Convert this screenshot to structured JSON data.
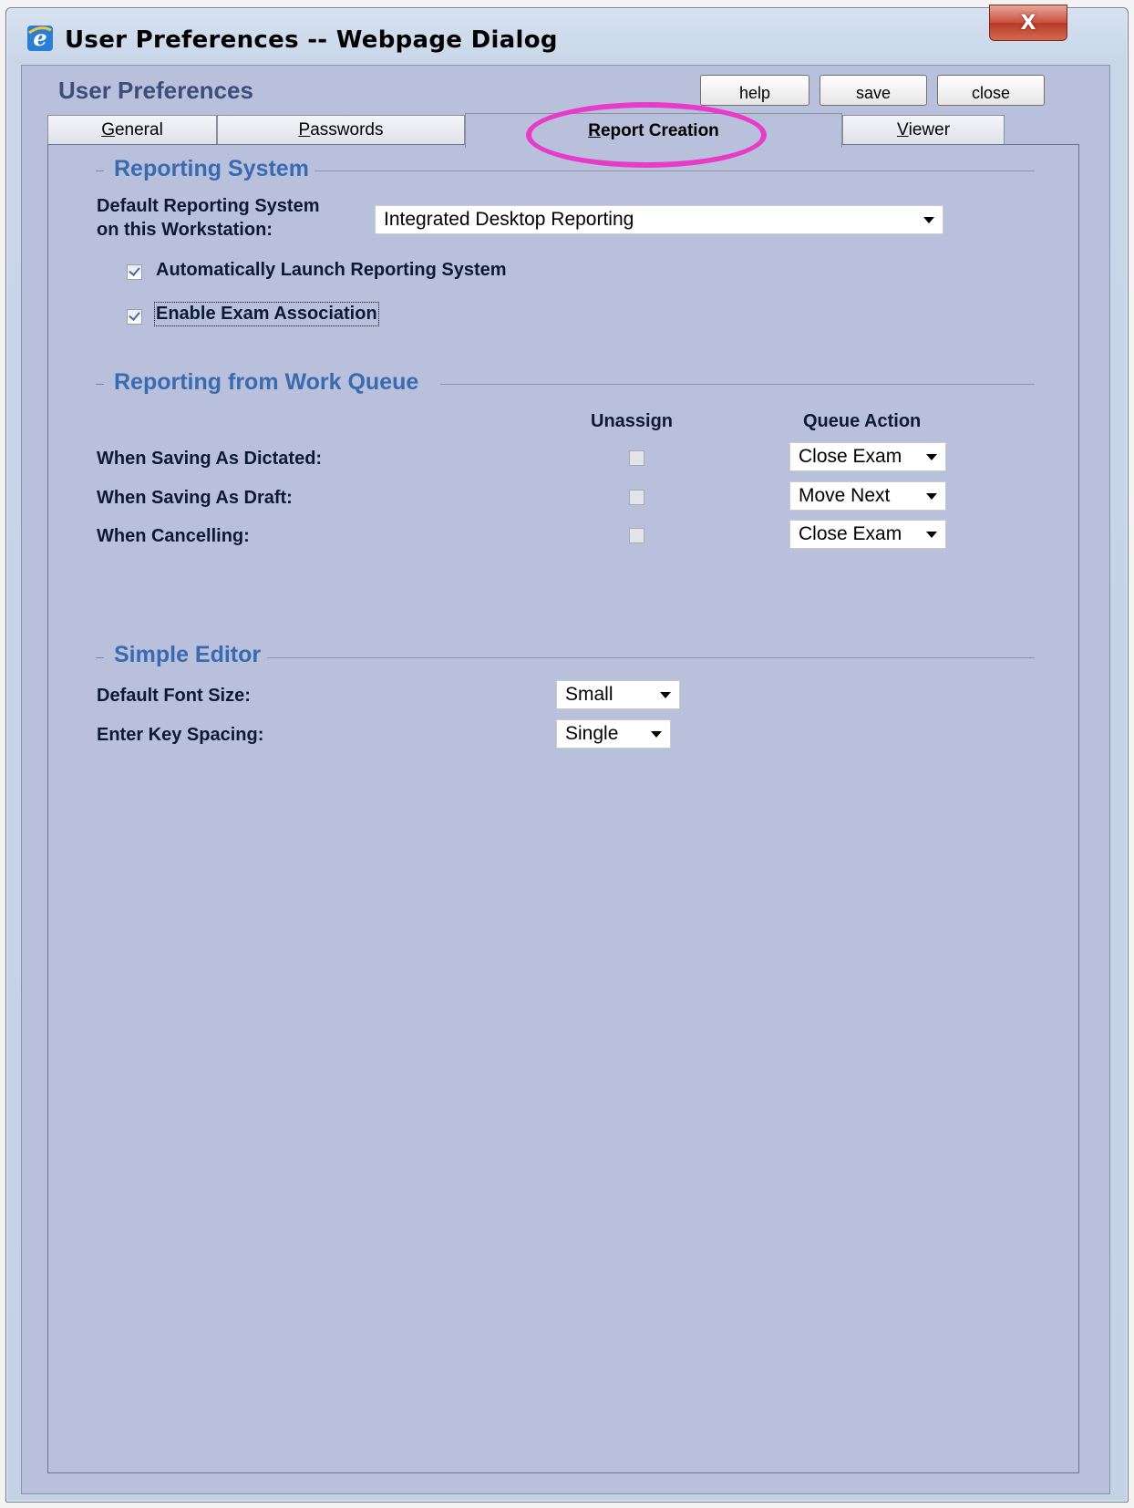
{
  "window": {
    "title": "User Preferences -- Webpage Dialog",
    "close_glyph": "X"
  },
  "header": {
    "app_title": "User Preferences",
    "buttons": {
      "help": "help",
      "save": "save",
      "close": "close"
    }
  },
  "tabs": [
    {
      "label": "General",
      "access_key": "G",
      "rest": "eneral"
    },
    {
      "label": "Passwords",
      "access_key": "P",
      "rest": "asswords"
    },
    {
      "label": "Report Creation",
      "access_key": "R",
      "rest": "eport Creation",
      "active": true
    },
    {
      "label": "Viewer",
      "access_key": "V",
      "rest": "iewer"
    }
  ],
  "reporting_system": {
    "heading": "Reporting System",
    "default_label_line1": "Default Reporting System",
    "default_label_line2": "on this Workstation:",
    "default_value": "Integrated Desktop Reporting",
    "auto_launch": {
      "label": "Automatically Launch Reporting System",
      "checked": true
    },
    "exam_assoc": {
      "label": "Enable Exam Association",
      "checked": true
    }
  },
  "work_queue": {
    "heading": "Reporting from Work Queue",
    "col_unassign": "Unassign",
    "col_queue_action": "Queue Action",
    "rows": [
      {
        "label": "When Saving As Dictated:",
        "unassign": false,
        "action": "Close Exam"
      },
      {
        "label": "When Saving As Draft:",
        "unassign": false,
        "action": "Move Next"
      },
      {
        "label": "When Cancelling:",
        "unassign": false,
        "action": "Close Exam"
      }
    ]
  },
  "simple_editor": {
    "heading": "Simple Editor",
    "font_size_label": "Default Font Size:",
    "font_size_value": "Small",
    "spacing_label": "Enter Key Spacing:",
    "spacing_value": "Single"
  },
  "colors": {
    "panel_bg": "#b8c0db",
    "section_heading": "#3a6ab0",
    "app_title": "#3b4f7a",
    "highlight": "#e73bc8"
  }
}
